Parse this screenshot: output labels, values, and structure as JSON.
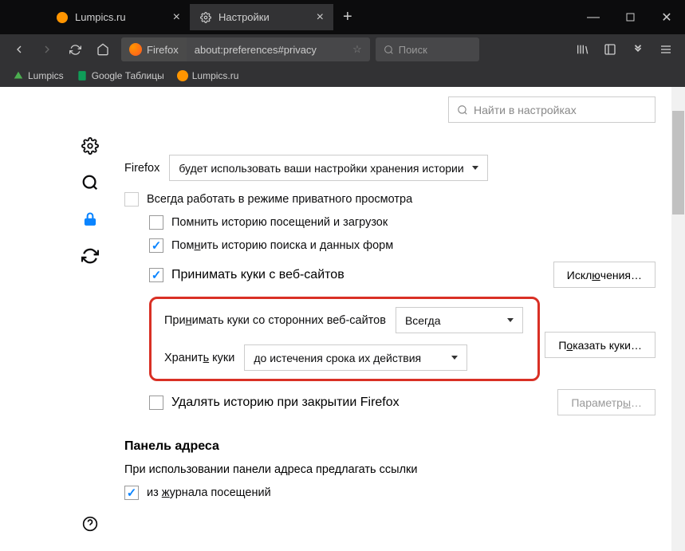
{
  "tabs": [
    {
      "label": "Lumpics.ru",
      "active": false
    },
    {
      "label": "Настройки",
      "active": true
    }
  ],
  "window": {
    "minimize": "—",
    "maximize": "☐",
    "close": "✕"
  },
  "urlbar": {
    "prefix": "Firefox",
    "url": "about:preferences#privacy"
  },
  "searchbox": {
    "placeholder": "Поиск"
  },
  "bookmarks": [
    {
      "label": "Lumpics"
    },
    {
      "label": "Google Таблицы"
    },
    {
      "label": "Lumpics.ru"
    }
  ],
  "prefs_search": {
    "placeholder": "Найти в настройках"
  },
  "fx_label": "Firefox",
  "history_mode": "будет использовать ваши настройки хранения истории",
  "checks": {
    "always_private": "Всегда работать в режиме приватного просмотра",
    "remember_history": "Помнить историю посещений и загрузок",
    "remember_forms": "Помнить историю поиска и данных форм",
    "accept_cookies": "Принимать куки с веб-сайтов",
    "thirdparty_label": "Принимать куки со сторонних веб-сайтов",
    "thirdparty_value": "Всегда",
    "keep_label": "Хранить куки",
    "keep_value": "до истечения срока их действия",
    "clear_on_close": "Удалять историю при закрытии Firefox",
    "from_history": "из журнала посещений"
  },
  "buttons": {
    "exceptions": "Исключения…",
    "show_cookies": "Показать куки…",
    "settings": "Параметры…"
  },
  "addressbar": {
    "title": "Панель адреса",
    "desc": "При использовании панели адреса предлагать ссылки"
  }
}
